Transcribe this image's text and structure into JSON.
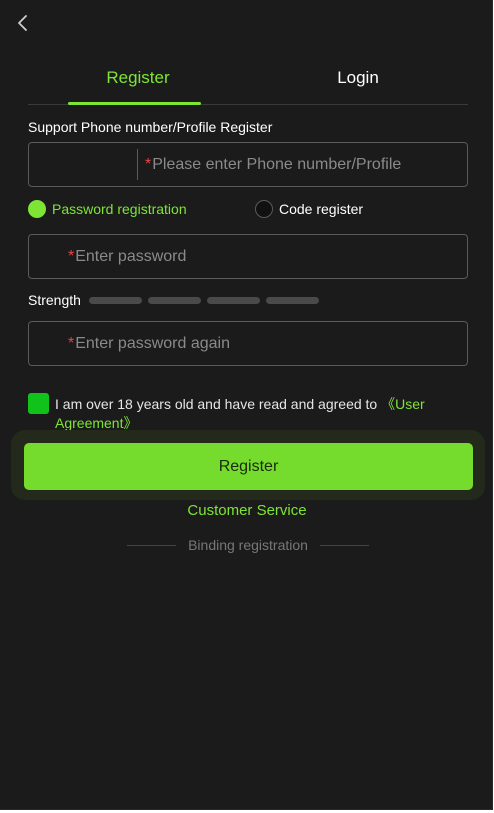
{
  "tabs": {
    "register": "Register",
    "login": "Login"
  },
  "form": {
    "support_label": "Support Phone number/Profile Register",
    "phone_placeholder": "Please enter Phone number/Profile",
    "required_mark": "*",
    "mode_password": "Password registration",
    "mode_code": "Code register",
    "password_placeholder": "Enter password",
    "strength_label": "Strength",
    "strength_level": 0,
    "strength_segments": 4,
    "password_again_placeholder": "Enter password again",
    "agreement_text": "I am over 18 years old and have read and agreed to ",
    "agreement_link": "《User Agreement》",
    "agreement_checked": true,
    "register_button": "Register"
  },
  "footer": {
    "customer_service": "Customer Service",
    "binding_registration": "Binding registration"
  },
  "colors": {
    "background": "#1b1b1b",
    "accent": "#7ee534",
    "button": "#75db2c",
    "checkbox": "#10c21a",
    "required": "#e84545"
  },
  "icons": {
    "back": "chevron-left-icon"
  }
}
